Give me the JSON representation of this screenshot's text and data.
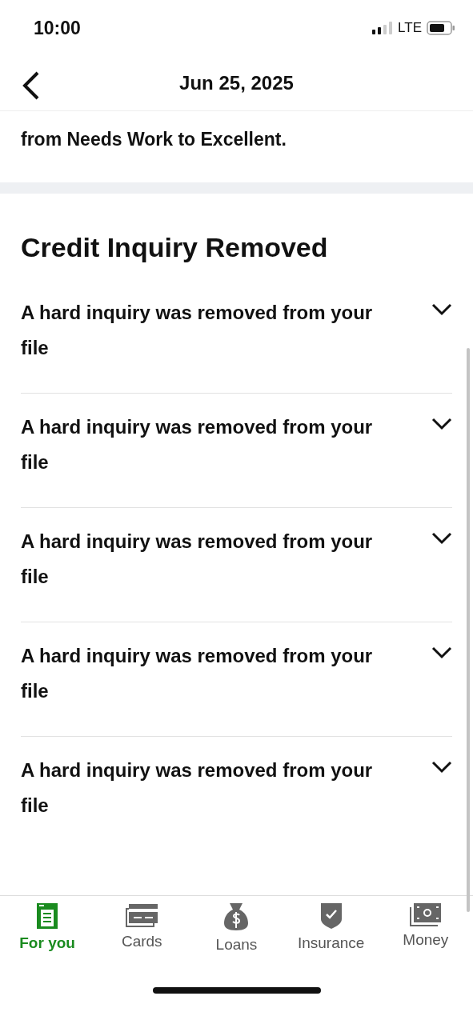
{
  "status_bar": {
    "time": "10:00",
    "network": "LTE"
  },
  "header": {
    "title": "Jun 25, 2025"
  },
  "previous_card": {
    "text": "from Needs Work to Excellent."
  },
  "section": {
    "title": "Credit Inquiry Removed",
    "items": [
      {
        "text": "A hard inquiry was removed from your file",
        "expanded": false
      },
      {
        "text": "A hard inquiry was removed from your file",
        "expanded": false
      },
      {
        "text": "A hard inquiry was removed from your file",
        "expanded": false
      },
      {
        "text": "A hard inquiry was removed from your file",
        "expanded": false
      },
      {
        "text": "A hard inquiry was removed from your file",
        "expanded": false
      }
    ]
  },
  "tab_bar": [
    {
      "label": "For you",
      "kind": "report",
      "selected": true
    },
    {
      "label": "Cards",
      "kind": "cards",
      "selected": false
    },
    {
      "label": "Loans",
      "kind": "bag",
      "selected": false
    },
    {
      "label": "Insurance",
      "kind": "shield",
      "selected": false
    },
    {
      "label": "Money",
      "kind": "cash",
      "selected": false
    }
  ]
}
